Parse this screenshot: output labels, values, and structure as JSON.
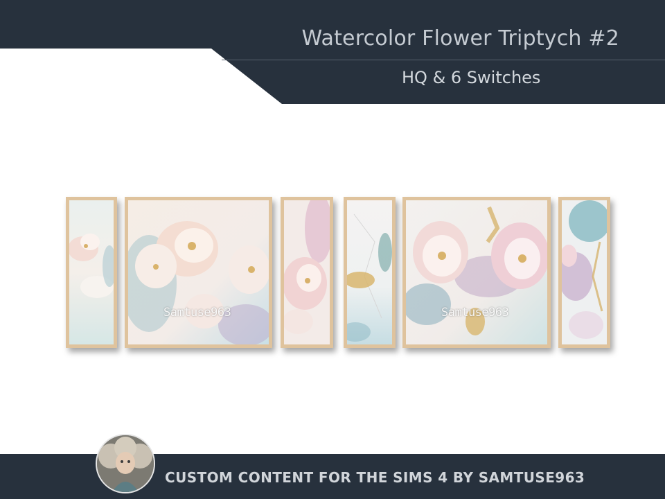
{
  "header": {
    "title": "Watercolor Flower Triptych #2",
    "subtitle": "HQ & 6 Switches"
  },
  "gallery": {
    "watermark": "Samtuse963",
    "frames": [
      "frame-1",
      "frame-2",
      "frame-3",
      "frame-4",
      "frame-5",
      "frame-6"
    ]
  },
  "footer": {
    "text": "CUSTOM CONTENT FOR THE SIMS 4 BY SAMTUSE963"
  },
  "colors": {
    "band": "#27313d",
    "frame": "#e3c8a3",
    "title_text": "#c5cbd2"
  }
}
